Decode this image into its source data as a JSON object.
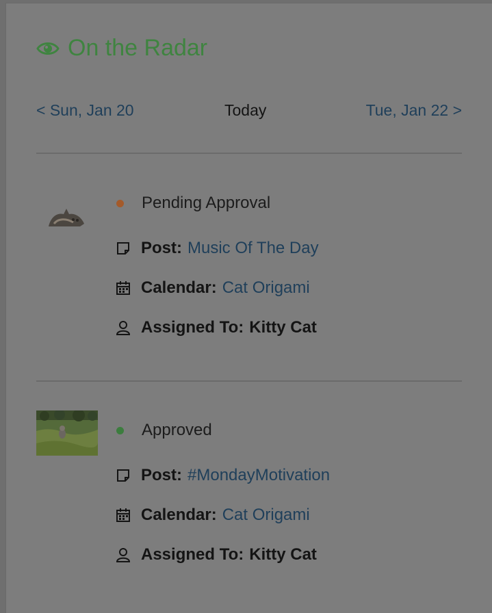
{
  "widget": {
    "title": "On the Radar",
    "title_icon": "eye-icon",
    "accent_color": "#3f8440"
  },
  "date_nav": {
    "prev_label": "< Sun, Jan 20",
    "current_label": "Today",
    "next_label": "Tue, Jan 22 >"
  },
  "items": [
    {
      "status": "Pending Approval",
      "status_color": "#a45a2a",
      "post_key": "Post:",
      "post_value": "Music Of The Day",
      "calendar_key": "Calendar:",
      "calendar_value": "Cat Origami",
      "assigned_key": "Assigned To:",
      "assigned_value": "Kitty Cat",
      "thumbnail": "cat-thumbnail"
    },
    {
      "status": "Approved",
      "status_color": "#3c7d3e",
      "post_key": "Post:",
      "post_value": "#MondayMotivation",
      "calendar_key": "Calendar:",
      "calendar_value": "Cat Origami",
      "assigned_key": "Assigned To:",
      "assigned_value": "Kitty Cat",
      "thumbnail": "cat-in-grass-thumbnail"
    }
  ]
}
